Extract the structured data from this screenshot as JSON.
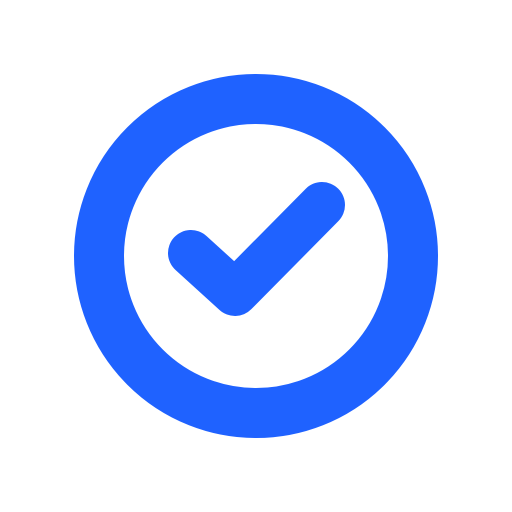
{
  "icon": {
    "name": "check-circle-icon",
    "colors": {
      "accent": "#1f62ff",
      "background": "#ffffff"
    }
  }
}
